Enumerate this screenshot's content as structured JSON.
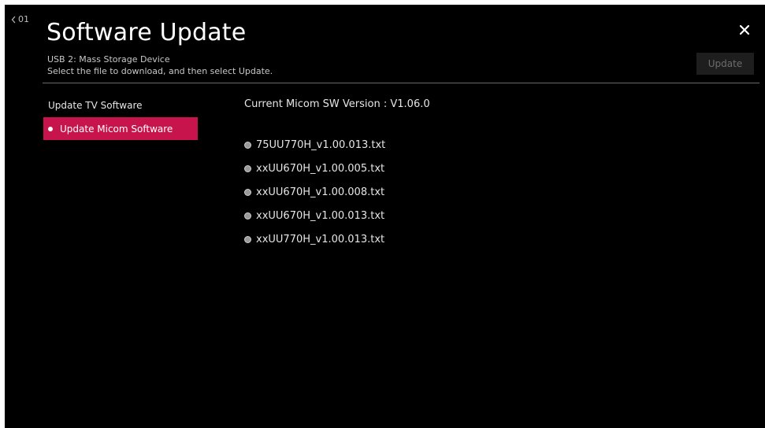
{
  "header": {
    "back_label": "01",
    "title": "Software Update",
    "subtitle_line1": "USB 2: Mass Storage Device",
    "subtitle_line2": "Select the file to download, and then select Update.",
    "update_label": "Update"
  },
  "sidebar": {
    "items": [
      {
        "label": "Update TV Software",
        "selected": false
      },
      {
        "label": "Update Micom Software",
        "selected": true
      }
    ]
  },
  "main": {
    "current_version": "Current Micom SW Version : V1.06.0",
    "files": [
      "75UU770H_v1.00.013.txt",
      "xxUU670H_v1.00.005.txt",
      "xxUU670H_v1.00.008.txt",
      "xxUU670H_v1.00.013.txt",
      "xxUU770H_v1.00.013.txt"
    ]
  },
  "colors": {
    "background": "#000000",
    "accent": "#c8144d",
    "text": "#e6e6e6",
    "disabled_button": "#1e1e1e"
  },
  "icons": {
    "back": "chevron-left-icon",
    "close": "close-icon",
    "selected": "dot-icon",
    "file": "radio-icon"
  }
}
